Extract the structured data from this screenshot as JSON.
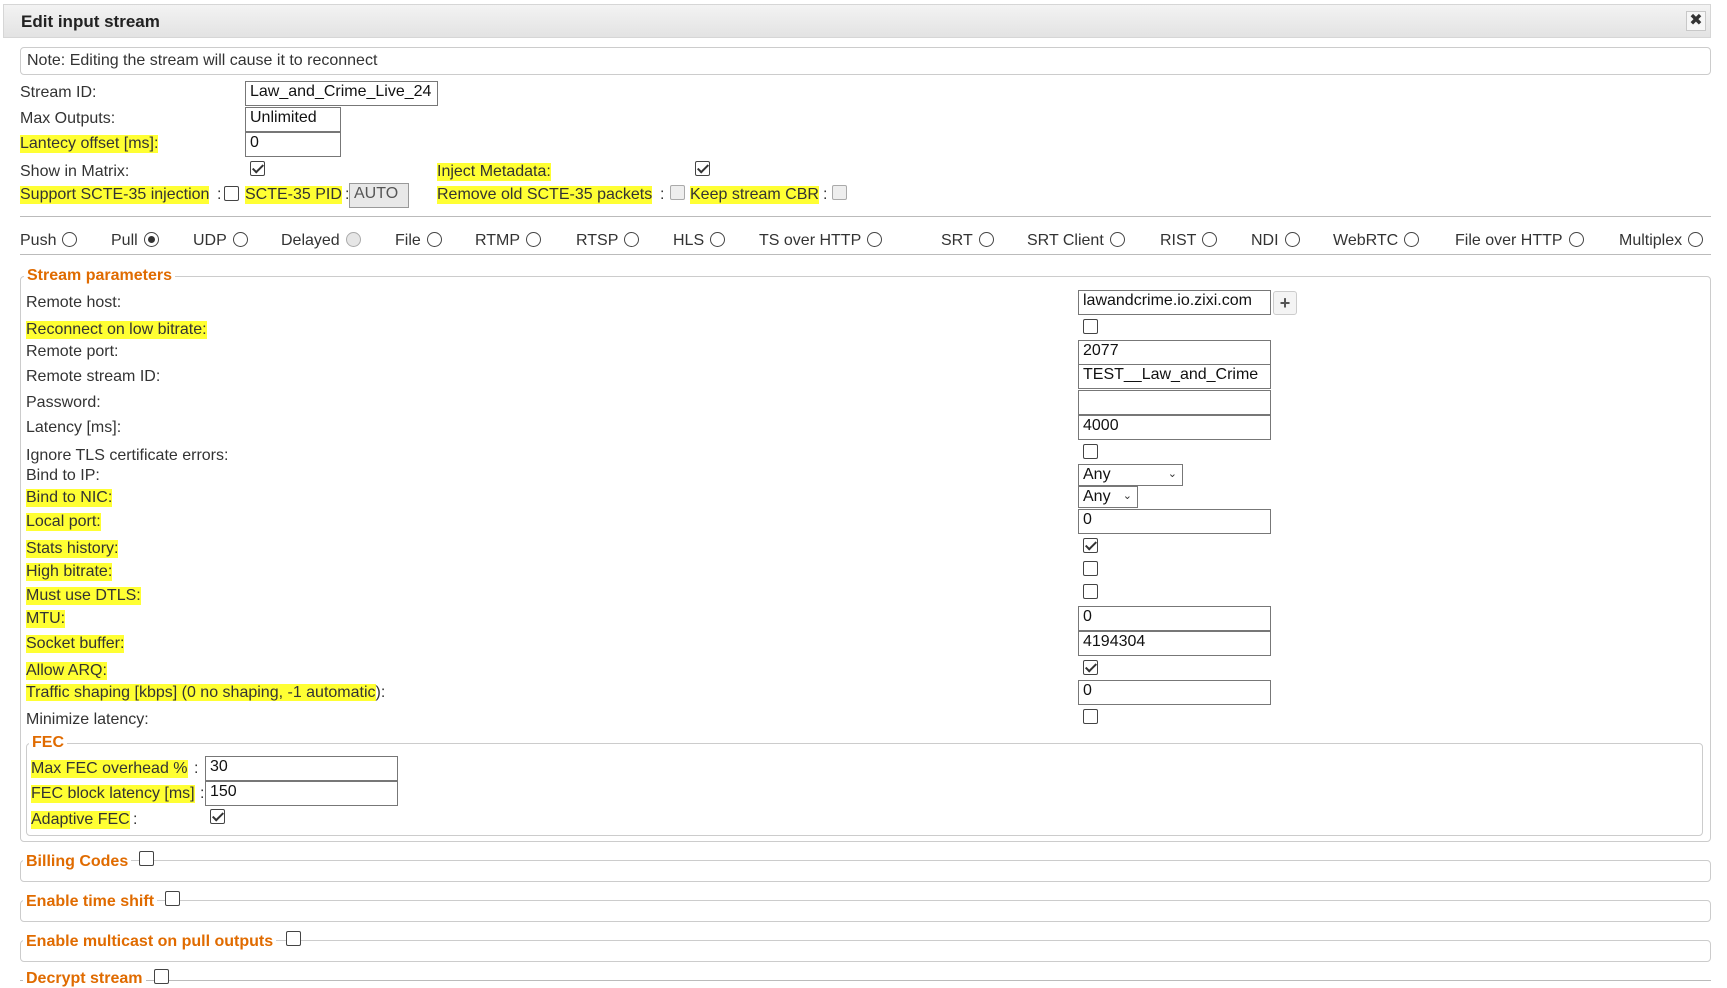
{
  "dialog": {
    "title": "Edit input stream",
    "close_glyph": "✖"
  },
  "note": "Note: Editing the stream will cause it to reconnect",
  "general": {
    "stream_id_label": "Stream ID:",
    "stream_id_value": "Law_and_Crime_Live_24",
    "max_outputs_label": "Max Outputs:",
    "max_outputs_value": "Unlimited",
    "latency_offset_label": "Lantecy offset [ms]:",
    "latency_offset_value": "0",
    "show_in_matrix_label": "Show in Matrix:",
    "show_in_matrix_checked": true,
    "inject_metadata_label": "Inject Metadata:",
    "inject_metadata_checked": true,
    "scte35_injection_label": "Support SCTE-35 injection",
    "scte35_pid_label": "SCTE-35 PID",
    "scte35_pid_value": "AUTO",
    "remove_scte35_label": "Remove old SCTE-35 packets",
    "keep_cbr_label": "Keep stream CBR",
    "colon": ":"
  },
  "protocols": [
    {
      "label": "Push",
      "checked": false,
      "disabled": false
    },
    {
      "label": "Pull",
      "checked": true,
      "disabled": false
    },
    {
      "label": "UDP",
      "checked": false,
      "disabled": false
    },
    {
      "label": "Delayed",
      "checked": false,
      "disabled": true
    },
    {
      "label": "File",
      "checked": false,
      "disabled": false
    },
    {
      "label": "RTMP",
      "checked": false,
      "disabled": false
    },
    {
      "label": "RTSP",
      "checked": false,
      "disabled": false
    },
    {
      "label": "HLS",
      "checked": false,
      "disabled": false
    },
    {
      "label": "TS over HTTP",
      "checked": false,
      "disabled": false
    },
    {
      "label": "SRT",
      "checked": false,
      "disabled": false
    },
    {
      "label": "SRT Client",
      "checked": false,
      "disabled": false
    },
    {
      "label": "RIST",
      "checked": false,
      "disabled": false
    },
    {
      "label": "NDI",
      "checked": false,
      "disabled": false
    },
    {
      "label": "WebRTC",
      "checked": false,
      "disabled": false
    },
    {
      "label": "File over HTTP",
      "checked": false,
      "disabled": false
    },
    {
      "label": "Multiplex",
      "checked": false,
      "disabled": false
    }
  ],
  "stream_params": {
    "legend": "Stream parameters",
    "remote_host_label": "Remote host:",
    "remote_host_value": "lawandcrime.io.zixi.com",
    "add_host_glyph": "+",
    "reconnect_low_bitrate_label": "Reconnect on low bitrate:",
    "reconnect_low_bitrate_checked": false,
    "remote_port_label": "Remote port:",
    "remote_port_value": "2077",
    "remote_stream_id_label": "Remote stream ID:",
    "remote_stream_id_value": "TEST__Law_and_Crime",
    "password_label": "Password:",
    "password_value": "",
    "latency_label": "Latency [ms]:",
    "latency_value": "4000",
    "ignore_tls_label": "Ignore TLS certificate errors:",
    "ignore_tls_checked": false,
    "bind_ip_label": "Bind to IP:",
    "bind_ip_value": "Any",
    "bind_nic_label": "Bind to NIC:",
    "bind_nic_value": "Any",
    "local_port_label": "Local port:",
    "local_port_value": "0",
    "stats_history_label": "Stats history:",
    "stats_history_checked": true,
    "high_bitrate_label": "High bitrate:",
    "high_bitrate_checked": false,
    "must_use_dtls_label": "Must use DTLS:",
    "must_use_dtls_checked": false,
    "mtu_label": "MTU:",
    "mtu_value": "0",
    "socket_buffer_label": "Socket buffer:",
    "socket_buffer_value": "4194304",
    "allow_arq_label": "Allow ARQ:",
    "allow_arq_checked": true,
    "traffic_shaping_label": "Traffic shaping [kbps] (0 no shaping, -1 automatic",
    "traffic_shaping_suffix": "):",
    "traffic_shaping_value": "0",
    "minimize_latency_label": "Minimize latency:",
    "minimize_latency_checked": false
  },
  "fec": {
    "legend": "FEC",
    "max_overhead_label": "Max FEC overhead %",
    "max_overhead_value": "30",
    "block_latency_label": "FEC block latency [ms]",
    "block_latency_value": "150",
    "adaptive_label": "Adaptive FEC",
    "adaptive_checked": true,
    "colon": ":"
  },
  "sections": {
    "billing_codes": "Billing Codes",
    "enable_time_shift": "Enable time shift",
    "enable_multicast": "Enable multicast on pull outputs",
    "decrypt_stream": "Decrypt stream"
  },
  "colors": {
    "legend": "#e06b00",
    "highlight": "#ffff33"
  }
}
